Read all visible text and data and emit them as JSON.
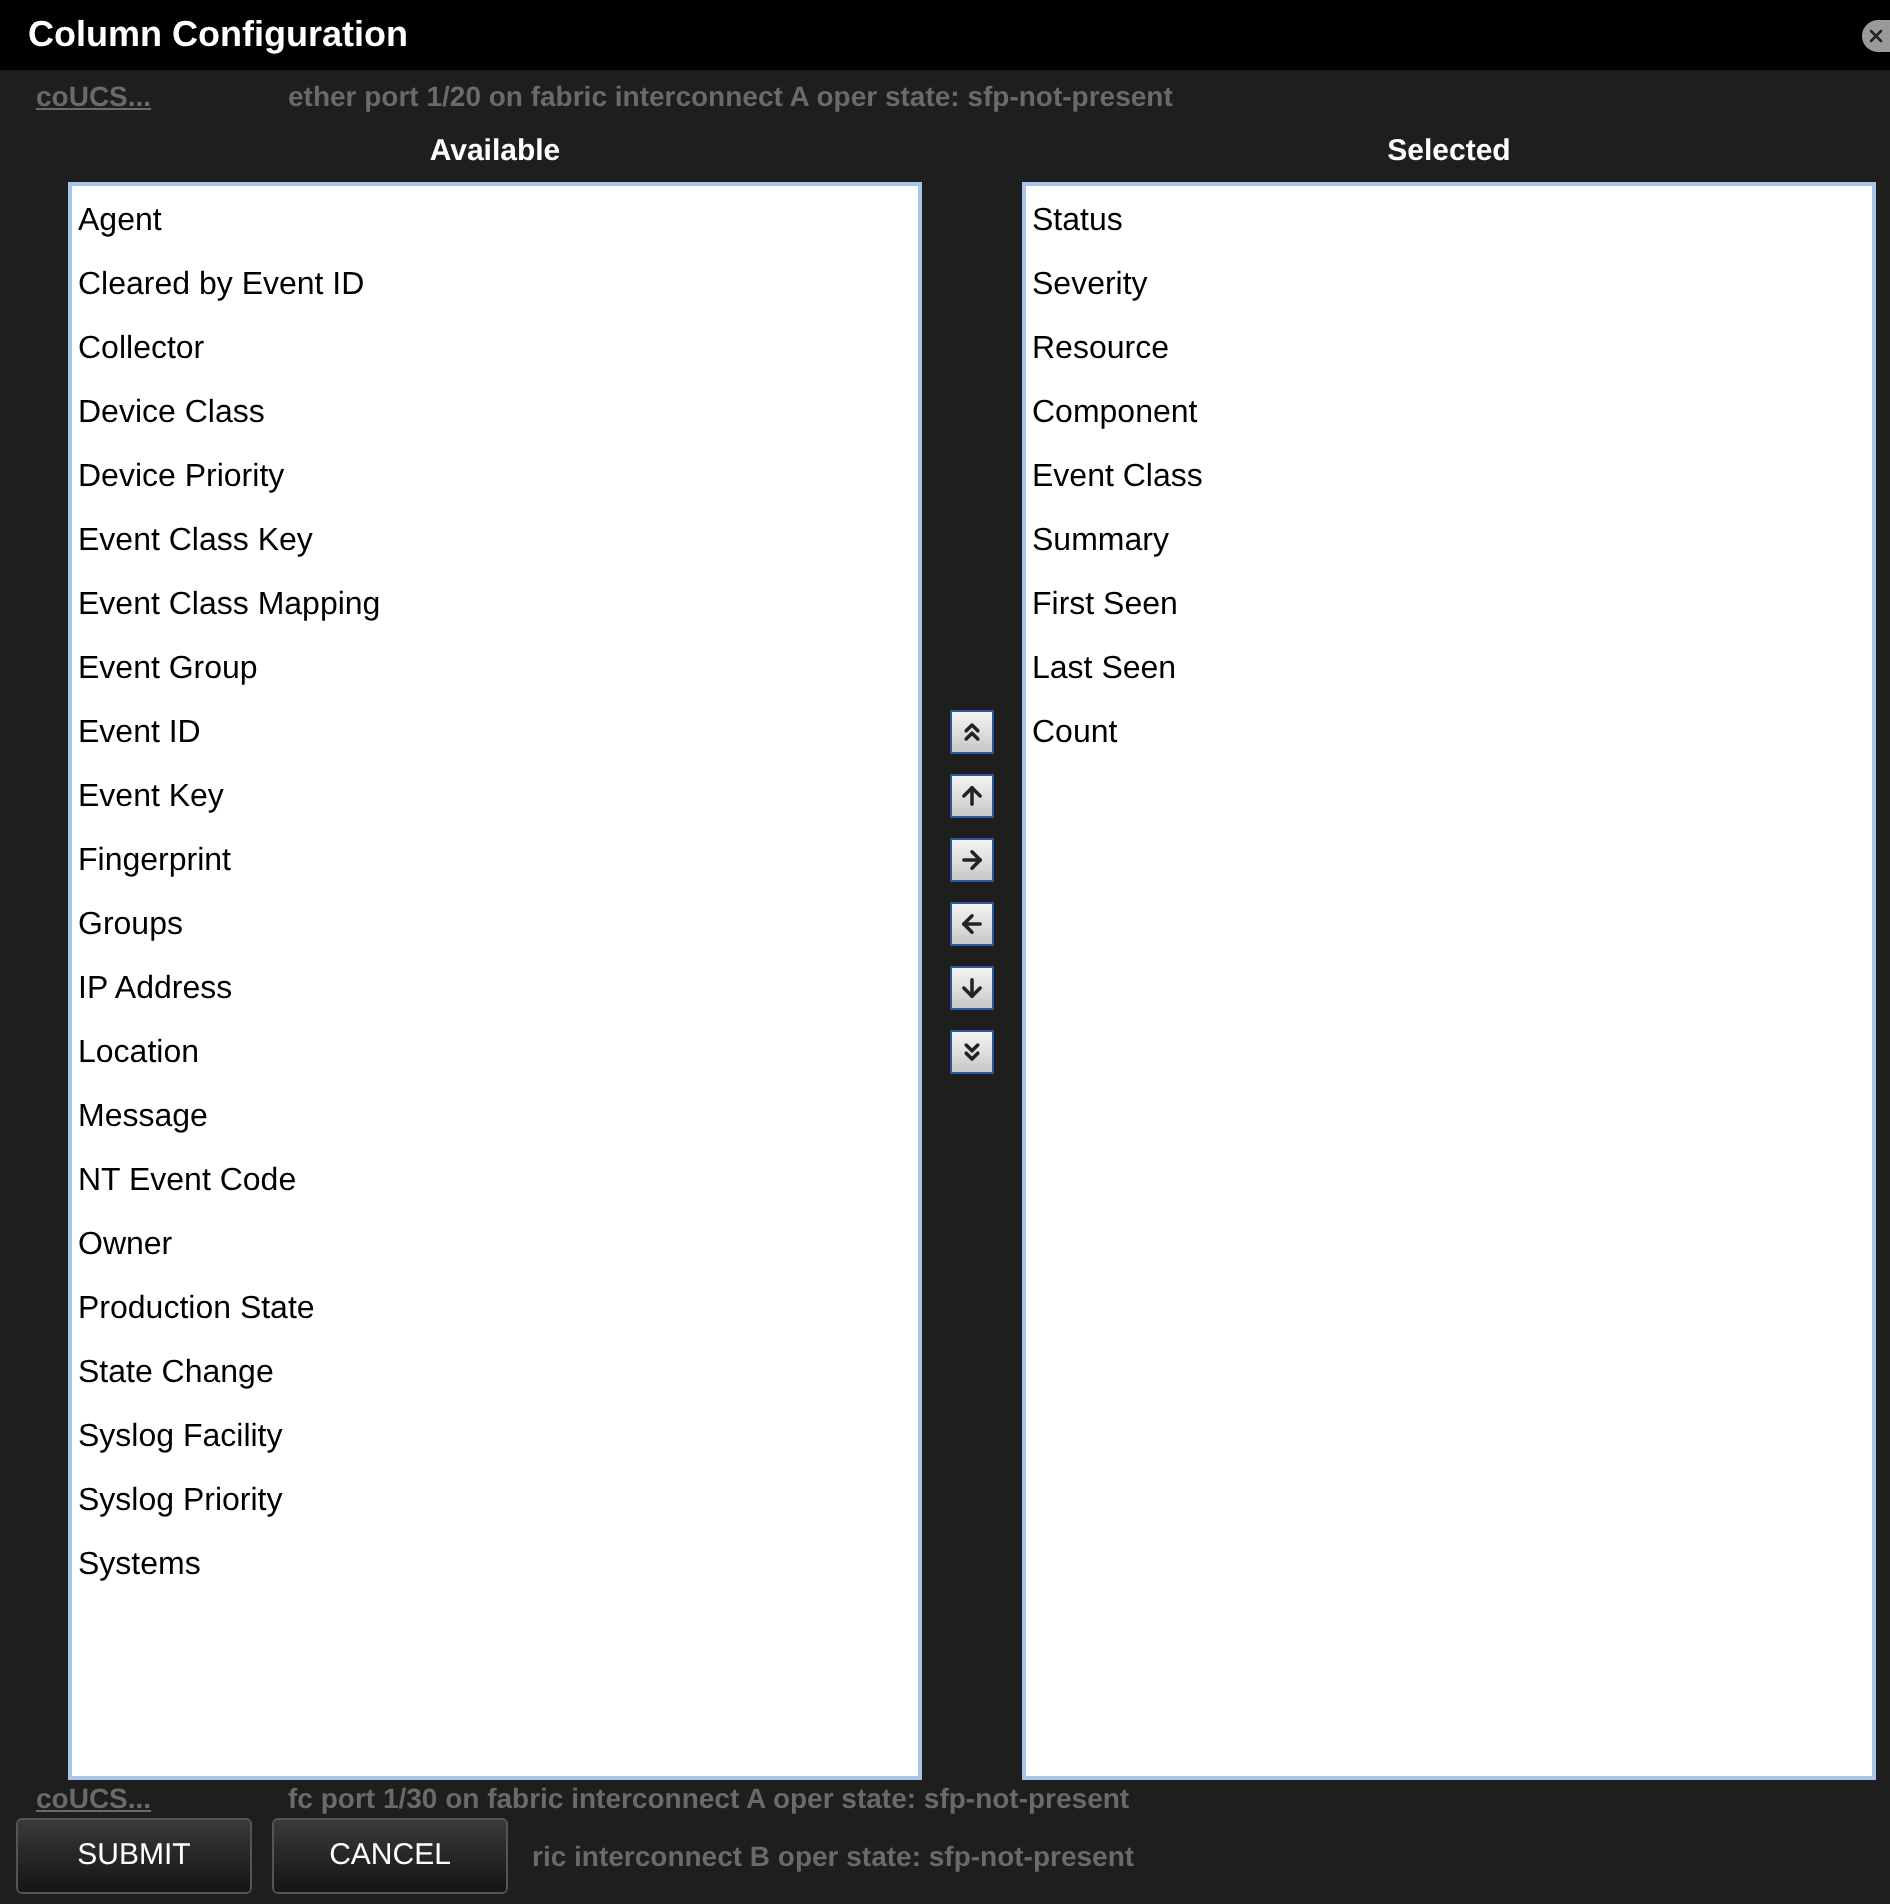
{
  "background_top_row": {
    "link": "coUCS...",
    "message": "ether port 1/20 on fabric interconnect A oper state: sfp-not-present"
  },
  "dialog": {
    "title": "Column Configuration",
    "available": {
      "heading": "Available",
      "items": [
        "Agent",
        "Cleared by Event ID",
        "Collector",
        "Device Class",
        "Device Priority",
        "Event Class Key",
        "Event Class Mapping",
        "Event Group",
        "Event ID",
        "Event Key",
        "Fingerprint",
        "Groups",
        "IP Address",
        "Location",
        "Message",
        "NT Event Code",
        "Owner",
        "Production State",
        "State Change",
        "Syslog Facility",
        "Syslog Priority",
        "Systems"
      ]
    },
    "selected": {
      "heading": "Selected",
      "items": [
        "Status",
        "Severity",
        "Resource",
        "Component",
        "Event Class",
        "Summary",
        "First Seen",
        "Last Seen",
        "Count"
      ]
    },
    "move_buttons": [
      {
        "kind": "top"
      },
      {
        "kind": "up"
      },
      {
        "kind": "add"
      },
      {
        "kind": "remove"
      },
      {
        "kind": "down"
      },
      {
        "kind": "bottom"
      }
    ],
    "buttons": [
      "SUBMIT",
      "CANCEL"
    ]
  },
  "background_bottom_rows": [
    {
      "link": "coUCS...",
      "message": "fc port 1/30 on fabric interconnect A oper state: sfp-not-present"
    },
    {
      "message": "ric interconnect B oper state: sfp-not-present"
    }
  ]
}
